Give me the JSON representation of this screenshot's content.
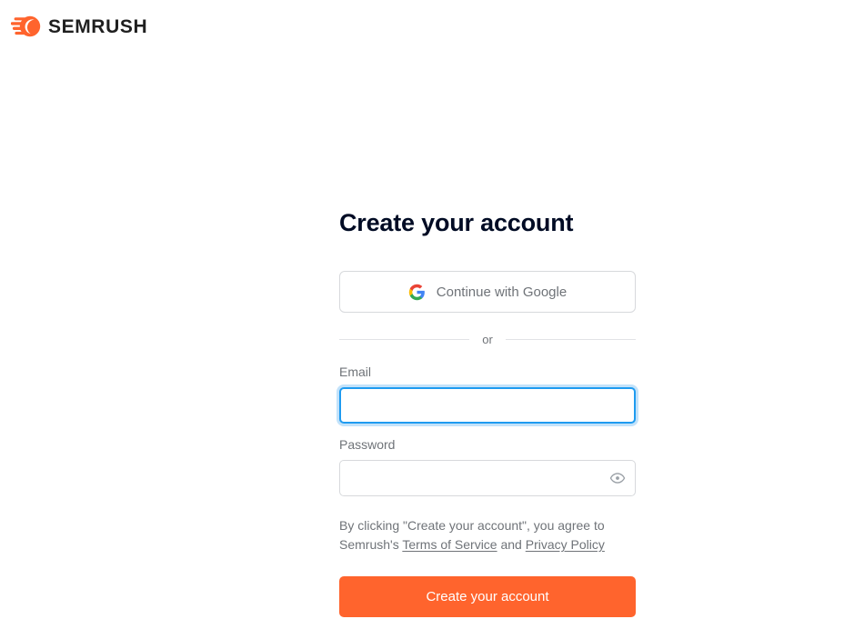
{
  "brand": {
    "name": "SEMRUSH",
    "logo_icon": "semrush-comet-icon",
    "accent_color": "#ff642d",
    "logo_text_color": "#1f1f1f"
  },
  "page": {
    "title": "Create your account",
    "title_color": "#000b24",
    "background_color": "#ffffff"
  },
  "social": {
    "google_label": "Continue with Google",
    "google_icon": "google-g-icon",
    "google_colors": {
      "red": "#ea4335",
      "yellow": "#fbbc05",
      "green": "#34a853",
      "blue": "#4285f4"
    }
  },
  "divider": {
    "text": "or",
    "line_color": "#e1e3e6"
  },
  "form": {
    "email": {
      "label": "Email",
      "value": "",
      "placeholder": "",
      "focused": true,
      "focus_border_color": "#1e9bf0"
    },
    "password": {
      "label": "Password",
      "value": "",
      "placeholder": "",
      "focused": false,
      "toggle_icon": "eye-icon",
      "toggle_icon_color": "#9aa0a6"
    },
    "border_color": "#d7d9dc",
    "label_color": "#6f7378"
  },
  "legal": {
    "text_before": "By clicking \"Create your account\", you agree to Semrush's ",
    "terms_link": "Terms of Service",
    "text_between": " and ",
    "privacy_link": "Privacy Policy",
    "text_color": "#6f7378"
  },
  "submit": {
    "label": "Create your account",
    "background_color": "#ff642d",
    "text_color": "#ffffff"
  }
}
